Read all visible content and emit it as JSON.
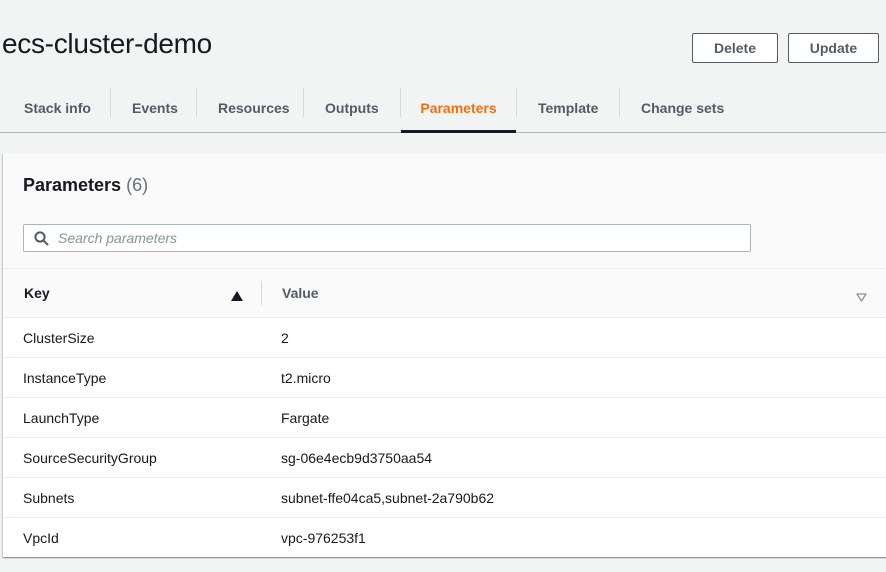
{
  "page": {
    "title": "ecs-cluster-demo"
  },
  "actions": {
    "delete_label": "Delete",
    "update_label": "Update"
  },
  "tabs": [
    {
      "label": "Stack info",
      "active": false
    },
    {
      "label": "Events",
      "active": false
    },
    {
      "label": "Resources",
      "active": false
    },
    {
      "label": "Outputs",
      "active": false
    },
    {
      "label": "Parameters",
      "active": true
    },
    {
      "label": "Template",
      "active": false
    },
    {
      "label": "Change sets",
      "active": false
    }
  ],
  "parameters": {
    "heading": "Parameters",
    "count": "(6)",
    "search_placeholder": "Search parameters",
    "columns": {
      "key": "Key",
      "value": "Value"
    },
    "sort": {
      "key_direction": "ascending"
    },
    "rows": [
      {
        "key": "ClusterSize",
        "value": "2"
      },
      {
        "key": "InstanceType",
        "value": "t2.micro"
      },
      {
        "key": "LaunchType",
        "value": "Fargate"
      },
      {
        "key": "SourceSecurityGroup",
        "value": "sg-06e4ecb9d3750aa54"
      },
      {
        "key": "Subnets",
        "value": "subnet-ffe04ca5,subnet-2a790b62"
      },
      {
        "key": "VpcId",
        "value": "vpc-976253f1"
      }
    ]
  },
  "colors": {
    "accent_orange": "#ec7211",
    "text_primary": "#16191f",
    "text_secondary": "#545b64",
    "background": "#f2f3f3"
  },
  "icons": {
    "search": "search-icon",
    "sort_key": "caret-up-icon",
    "sort_value": "caret-down-outline-icon"
  }
}
